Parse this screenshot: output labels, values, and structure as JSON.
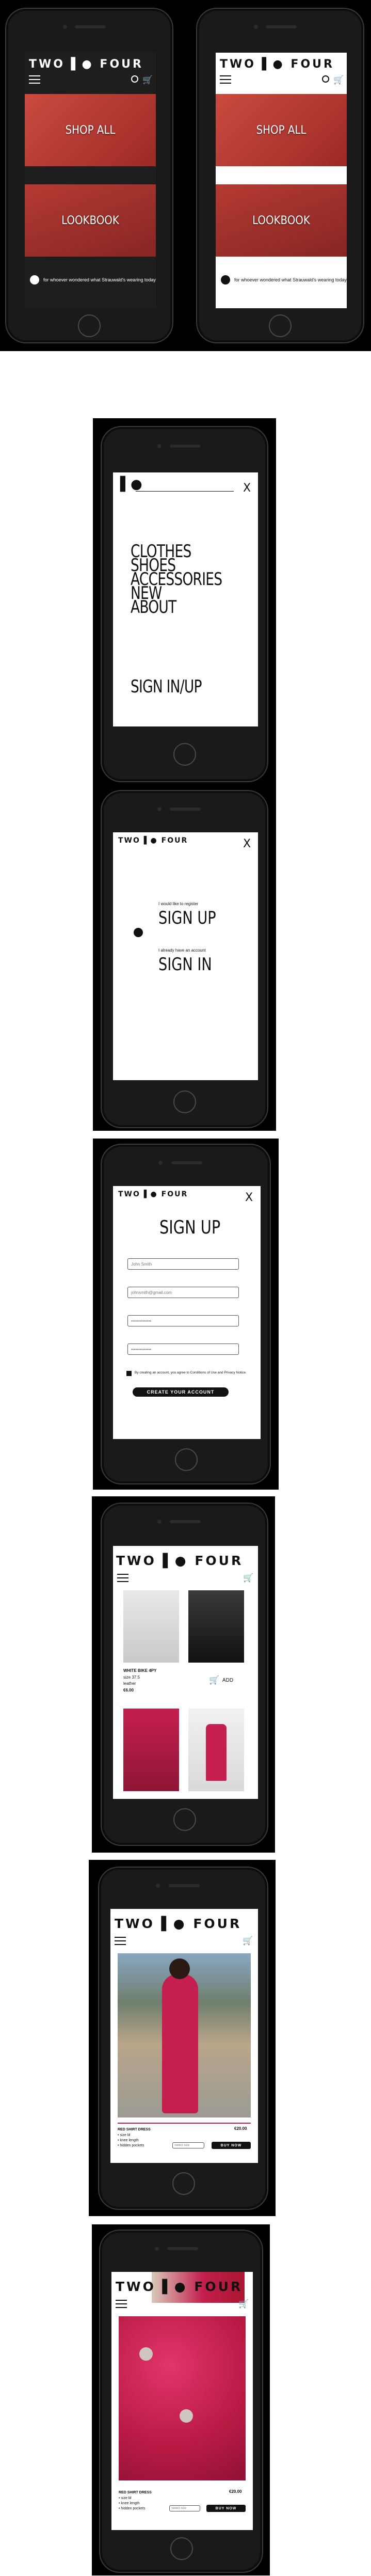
{
  "brand": {
    "logo": "TWO ▌● FOUR",
    "logo_short": "▌●"
  },
  "home": {
    "shop_all": "SHOP ALL",
    "lookbook": "LOOKBOOK",
    "marquee": "for whoever wondered what Strauwald's wearing today"
  },
  "menu": {
    "close": "X",
    "items": [
      "CLOTHES",
      "SHOES",
      "ACCESSORIES",
      "NEW",
      "ABOUT"
    ],
    "sign_in_up": "SIGN IN/UP"
  },
  "auth_choice": {
    "register_prompt": "I would like to register",
    "sign_up": "SIGN UP",
    "account_prompt": "I already have an account",
    "sign_in": "SIGN IN"
  },
  "signup_form": {
    "title": "SIGN UP",
    "fields": [
      {
        "placeholder": "John Smith"
      },
      {
        "placeholder": "johnsmith@gmail.com"
      },
      {
        "placeholder": "••••••••••••••"
      },
      {
        "placeholder": "••••••••••••••"
      }
    ],
    "terms": "By creating an account, you agree to Conditions of Use and Privacy Notice.",
    "submit": "CREATE YOUR ACCOUNT"
  },
  "catalog": {
    "product_name": "WHITE BIKE 4PY",
    "product_lines": [
      "size 37.5",
      "leather"
    ],
    "price": "€6.00",
    "add": "ADD"
  },
  "product": {
    "name": "RED SHIRT DRESS",
    "price": "€20.00",
    "details": [
      "• size M",
      "• knee length",
      "• hidden pockets"
    ],
    "size_placeholder": "Select size",
    "buy": "BUY NOW"
  },
  "colors": {
    "red": "#c8283c",
    "tile_bg": "#b3302f",
    "dress": "#c41f4e",
    "dark": "#111111"
  }
}
